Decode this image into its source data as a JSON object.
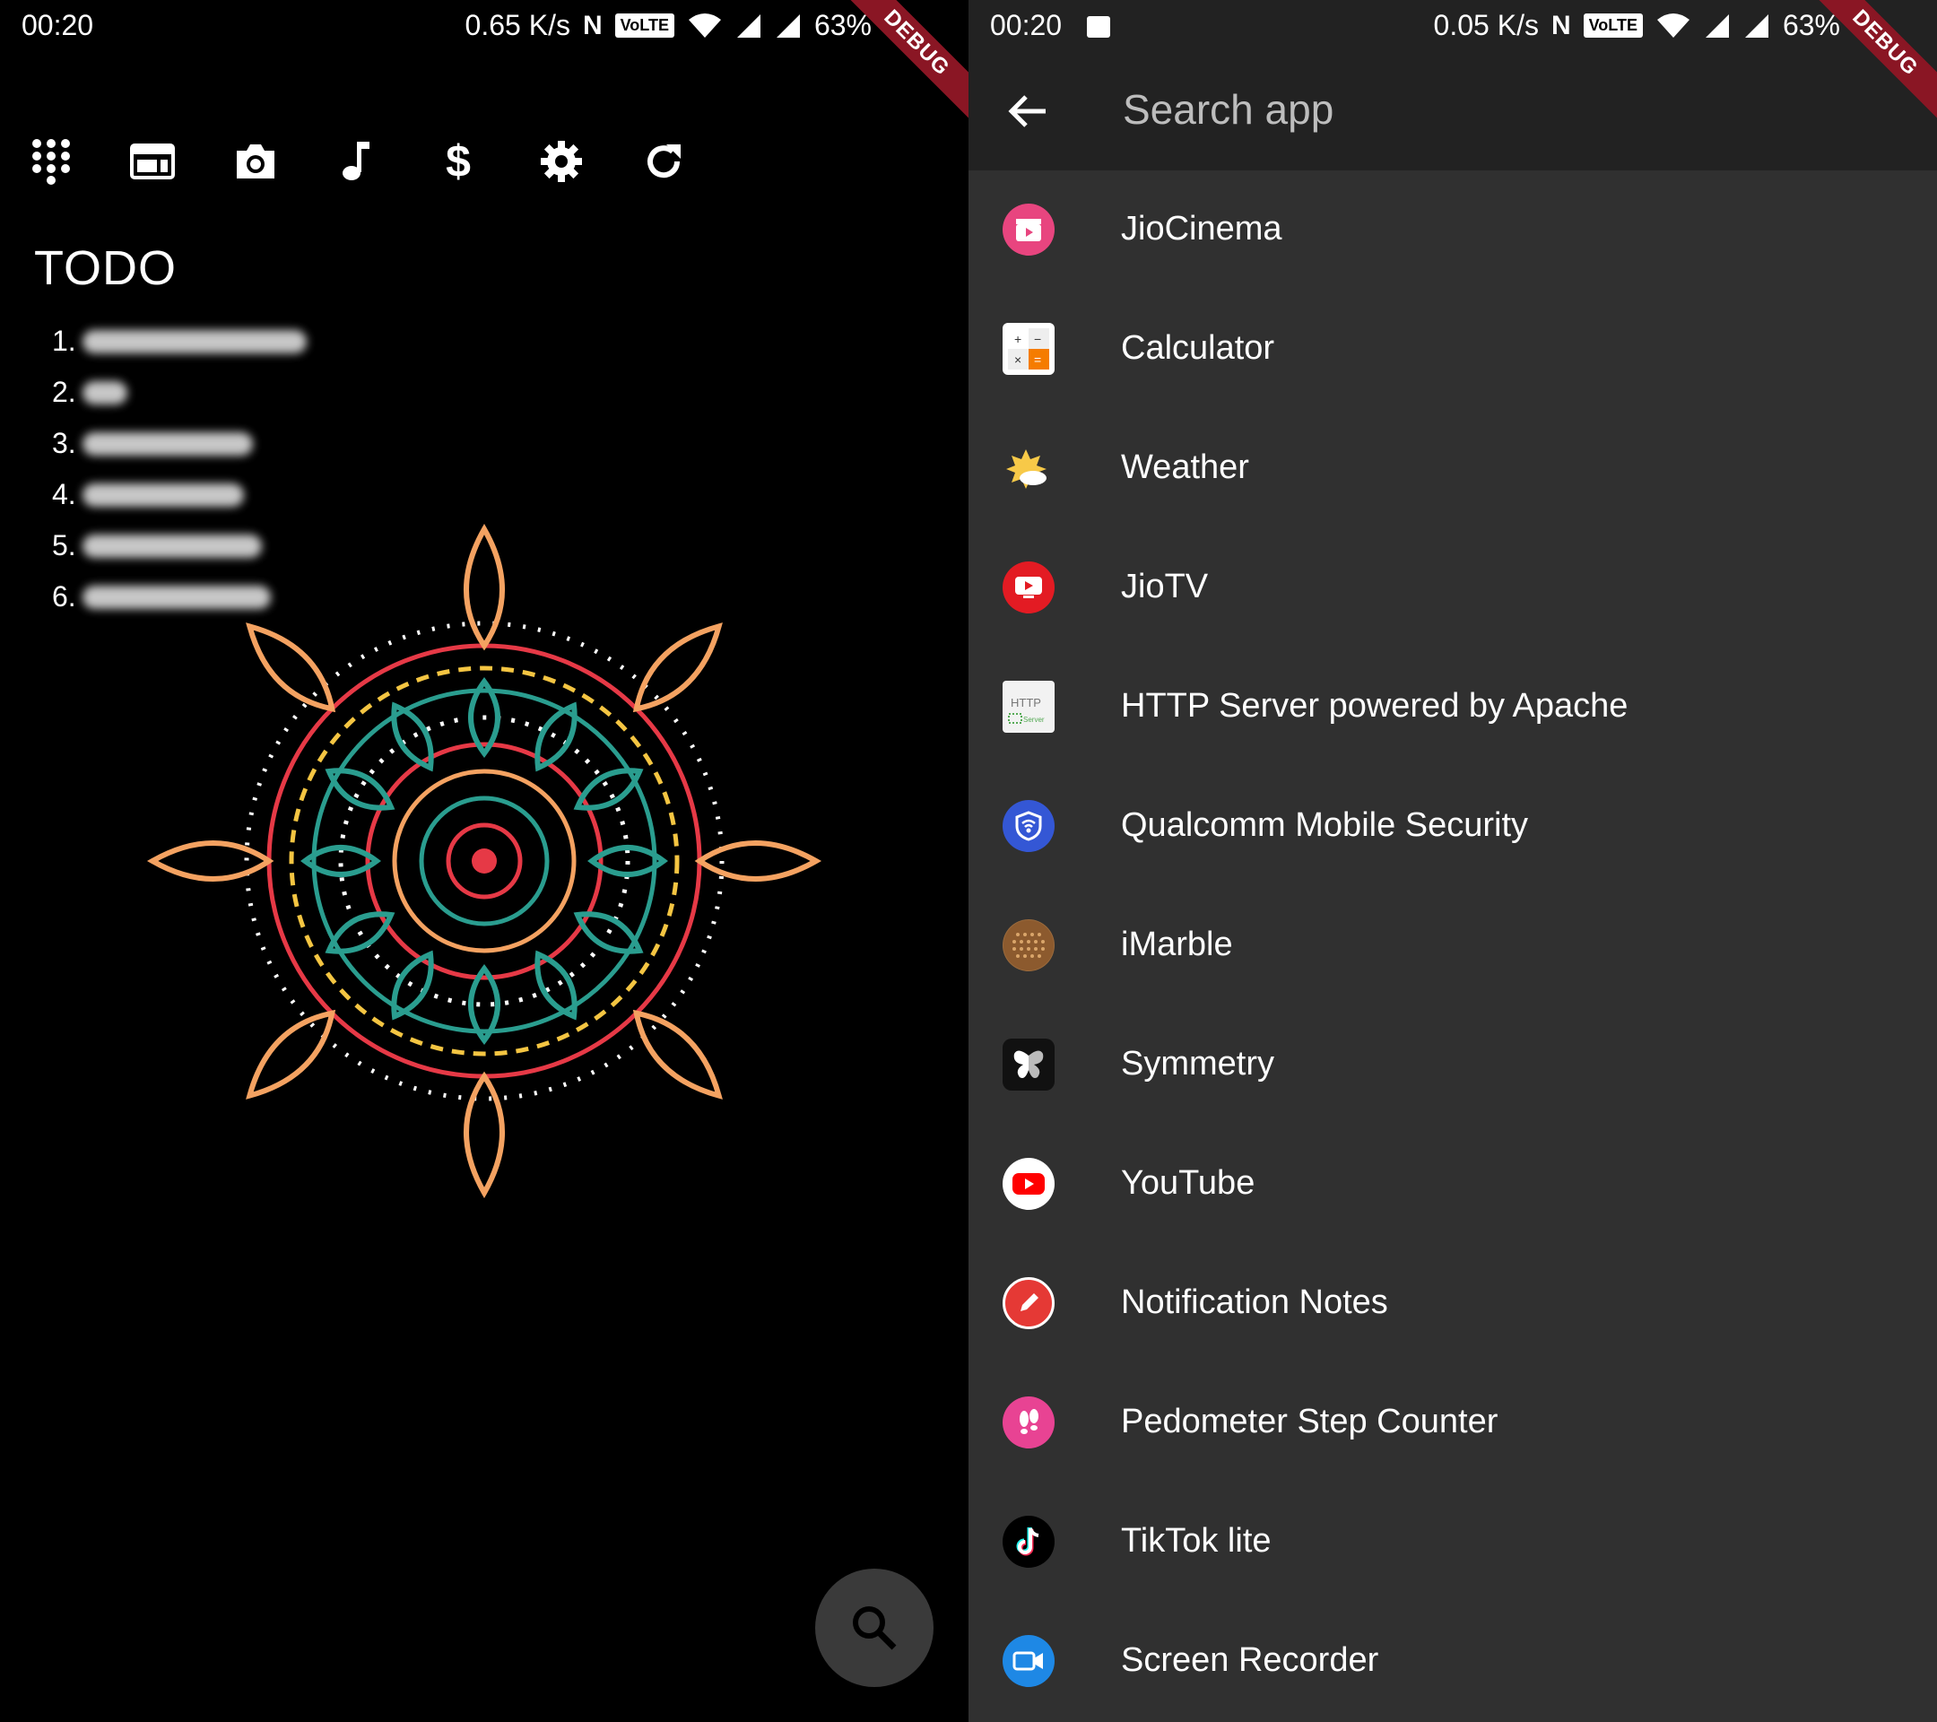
{
  "left_screen": {
    "status": {
      "time": "00:20",
      "speed": "0.65 K/s",
      "volte": "VoLTE",
      "nfc": "N",
      "battery": "63%"
    },
    "debug_banner": "DEBUG",
    "toolbar": {
      "icons": [
        "apps-grid-icon",
        "browser-window-icon",
        "camera-icon",
        "music-note-icon",
        "dollar-icon",
        "settings-gear-icon",
        "refresh-icon"
      ]
    },
    "todo": {
      "title": "TODO",
      "items": [
        "1.",
        "2.",
        "3.",
        "4.",
        "5.",
        "6."
      ]
    },
    "fab": {
      "icon": "search-icon"
    }
  },
  "right_screen": {
    "status": {
      "time": "00:20",
      "speed": "0.05 K/s",
      "volte": "VoLTE",
      "nfc": "N",
      "battery": "63%"
    },
    "debug_banner": "DEBUG",
    "search": {
      "placeholder": "Search app",
      "back_icon": "arrow-back-icon"
    },
    "apps": [
      {
        "label": "JioCinema",
        "icon": "jiocinema-icon",
        "color": "#e8457f"
      },
      {
        "label": "Calculator",
        "icon": "calculator-icon",
        "color": "#ffffff"
      },
      {
        "label": "Weather",
        "icon": "weather-icon",
        "color": "#f7c948"
      },
      {
        "label": "JioTV",
        "icon": "jiotv-icon",
        "color": "#e31b23"
      },
      {
        "label": "HTTP Server powered by Apache",
        "icon": "http-server-icon",
        "color": "#f2f2f2"
      },
      {
        "label": "Qualcomm Mobile Security",
        "icon": "shield-icon",
        "color": "#3457d5"
      },
      {
        "label": "iMarble",
        "icon": "imarble-icon",
        "color": "#9a6a3c"
      },
      {
        "label": "Symmetry",
        "icon": "butterfly-icon",
        "color": "#111111"
      },
      {
        "label": "YouTube",
        "icon": "youtube-icon",
        "color": "#ff0000"
      },
      {
        "label": "Notification Notes",
        "icon": "pencil-icon",
        "color": "#e53935"
      },
      {
        "label": "Pedometer Step Counter",
        "icon": "footsteps-icon",
        "color": "#e84393"
      },
      {
        "label": "TikTok lite",
        "icon": "tiktok-icon",
        "color": "#000000"
      },
      {
        "label": "Screen Recorder",
        "icon": "video-camera-icon",
        "color": "#1e88e5"
      }
    ]
  }
}
